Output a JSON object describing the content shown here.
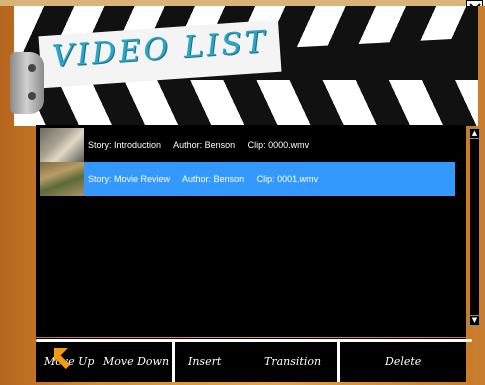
{
  "header": {
    "title": "VIDEO LIST"
  },
  "list": {
    "items": [
      {
        "story_label": "Story: Introduction",
        "author_label": "Author: Benson",
        "clip_label": "Clip: 0000.wmv",
        "selected": false
      },
      {
        "story_label": "Story: Movie Review",
        "author_label": "Author: Benson",
        "clip_label": "Clip: 0001.wmv",
        "selected": true
      }
    ],
    "selection_color": "#3399ff"
  },
  "toolbar": {
    "move_up_label": "Move Up",
    "move_down_label": "Move Down",
    "insert_label": "Insert",
    "transition_label": "Transition",
    "delete_label": "Delete"
  },
  "icons": {
    "close": "close-icon",
    "scroll_up": "scroll-up-arrow-icon",
    "scroll_down": "scroll-down-arrow-icon",
    "cursor": "mouse-cursor-icon"
  },
  "colors": {
    "frame": "#d98a2c",
    "title_text": "#2aa7c7",
    "list_background": "#000000"
  }
}
